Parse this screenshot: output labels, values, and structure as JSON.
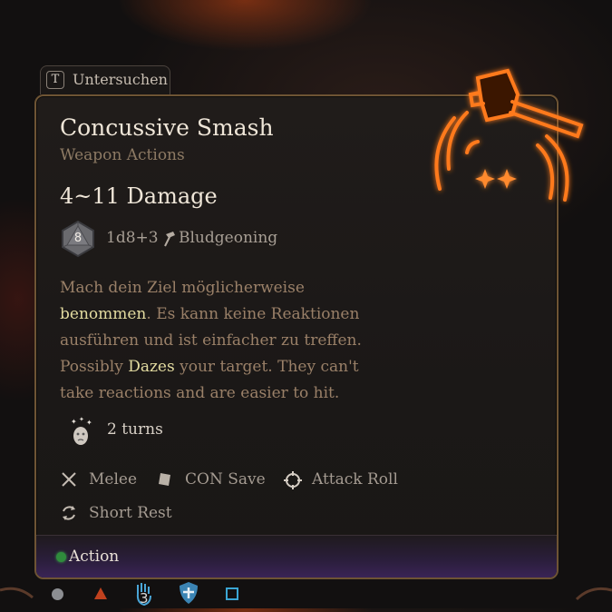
{
  "inspect": {
    "key": "T",
    "label": "Untersuchen"
  },
  "tooltip": {
    "title": "Concussive Smash",
    "subtitle": "Weapon Actions",
    "damage": "4~11 Damage",
    "die_value": "8",
    "formula": "1d8+3",
    "damage_type": "Bludgeoning",
    "description": {
      "de_part1": "Mach dein Ziel möglicherweise ",
      "de_highlight": "benommen",
      "de_part2": ". Es kann keine Reaktionen ausführen und ist einfacher zu treffen.",
      "en_part1": "Possibly ",
      "en_highlight": "Dazes",
      "en_part2": " your target. They can't take reactions and are easier to hit."
    },
    "duration": "2 turns",
    "tags": {
      "melee": "Melee",
      "save": "CON Save",
      "attack": "Attack Roll",
      "rest": "Short Rest"
    },
    "footer": "Action"
  },
  "hotbar": {
    "stack_count": "3"
  },
  "colors": {
    "accent_glow": "#ff6a1a",
    "highlight": "#e3dba0",
    "action_dot": "#2f8b3c",
    "border": "#6e5434"
  },
  "icons": [
    "dice-d8-icon",
    "hammer-icon",
    "dazed-icon",
    "crossed-swords-icon",
    "save-shield-icon",
    "crosshair-icon",
    "short-rest-icon",
    "concussive-smash-icon"
  ]
}
